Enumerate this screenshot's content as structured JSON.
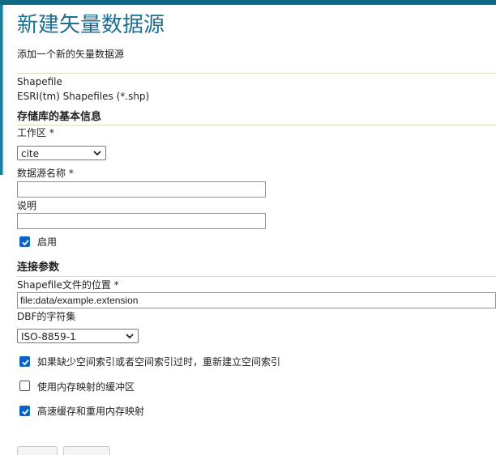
{
  "page": {
    "title": "新建矢量数据源",
    "subtitle": "添加一个新的矢量数据源"
  },
  "datasource_type": {
    "name": "Shapefile",
    "description": "ESRI(tm) Shapefiles (*.shp)"
  },
  "basic_info": {
    "heading": "存储库的基本信息",
    "workspace_label": "工作区 *",
    "workspace_value": "cite",
    "name_label": "数据源名称 *",
    "name_value": "",
    "description_label": "说明",
    "description_value": "",
    "enabled_label": "启用",
    "enabled_checked": true
  },
  "connection": {
    "heading": "连接参数",
    "location_label": "Shapefile文件的位置 *",
    "location_value": "file:data/example.extension",
    "charset_label": "DBF的字符集",
    "charset_value": "ISO-8859-1",
    "options": [
      {
        "label": "如果缺少空间索引或者空间索引过时，重新建立空间索引",
        "checked": true
      },
      {
        "label": "使用内存映射的缓冲区",
        "checked": false
      },
      {
        "label": "高速缓存和重用内存映射",
        "checked": true
      }
    ]
  },
  "colors": {
    "title": "#1f6f91",
    "topbar": "#0d6b86",
    "checkbox_accent": "#0b63c7",
    "separator": "#d7dfb9"
  }
}
